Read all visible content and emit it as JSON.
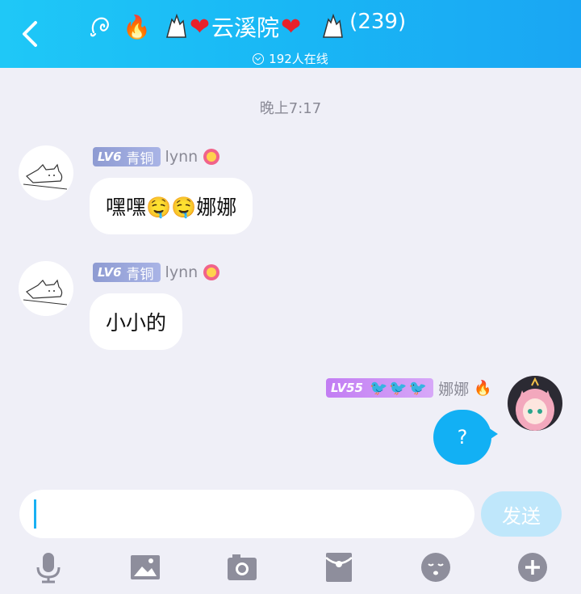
{
  "header": {
    "group_name": "云溪院",
    "member_count": "(239)",
    "online_text": "192人在线",
    "accent": "#19b7f5"
  },
  "chat": {
    "timestamp": "晚上7:17",
    "messages": [
      {
        "level": "LV6",
        "rank": "青铜",
        "nickname": "lynn",
        "text": "嘿嘿🤤🤤娜娜"
      },
      {
        "level": "LV6",
        "rank": "青铜",
        "nickname": "lynn",
        "text": "小小的"
      },
      {
        "level": "LV55",
        "nickname": "娜娜",
        "text": "?",
        "badge_icons": [
          "bird-icon",
          "bird-icon",
          "bird-icon"
        ]
      }
    ]
  },
  "composer": {
    "input_value": "",
    "send_label": "发送"
  },
  "toolbar": {
    "icons": [
      "microphone-icon",
      "image-icon",
      "camera-icon",
      "red-packet-icon",
      "emoji-icon",
      "plus-icon"
    ]
  }
}
